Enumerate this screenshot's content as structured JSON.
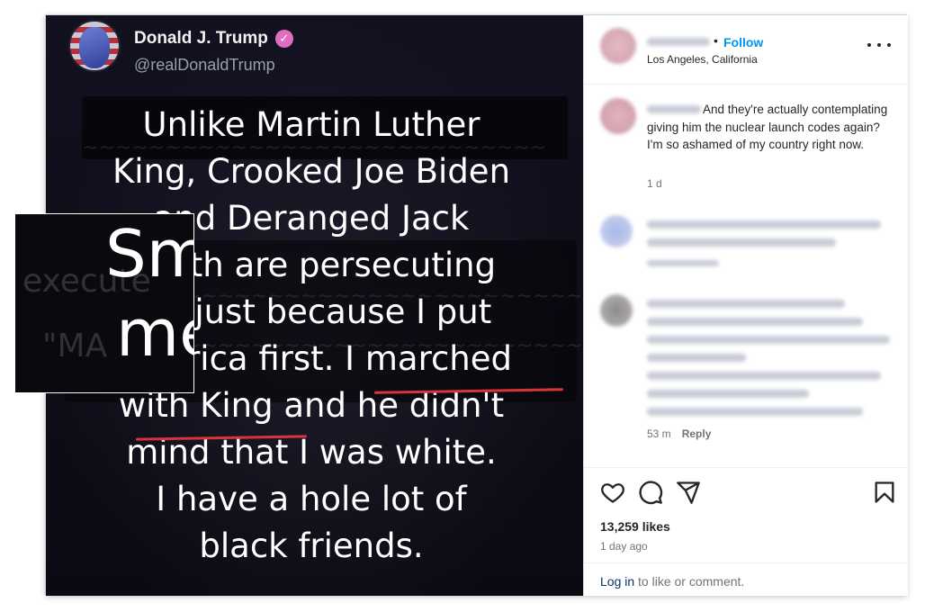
{
  "tweet": {
    "author_name": "Donald J. Trump",
    "author_handle": "@realDonaldTrump",
    "lines": [
      "Unlike Martin Luther",
      "King, Crooked Joe Biden",
      "and Deranged Jack",
      "Smith are persecuting",
      "me just because I put",
      "America first. I marched",
      "with King and he didn't",
      "mind that I was white.",
      "I have a hole lot of",
      "black friends."
    ]
  },
  "post": {
    "username_hidden": "blurred",
    "follow_label": "Follow",
    "location": "Los Angeles, California",
    "likes": "13,259 likes",
    "time_ago": "1 day ago",
    "login_link": "Log in",
    "login_suffix": " to like or comment."
  },
  "comments": [
    {
      "text": "And they're actually contemplating giving him the nuclear launch codes again? I'm so ashamed of my country right now.",
      "age": "1 d"
    },
    {
      "age": "53 m",
      "reply": "Reply"
    }
  ],
  "icons": [
    "verified-badge-icon",
    "more-options-icon",
    "heart-icon",
    "comment-icon",
    "share-icon",
    "bookmark-icon"
  ],
  "colors": {
    "follow": "#0095f6",
    "underline": "#d8353a",
    "verified": "#e06ec0"
  }
}
